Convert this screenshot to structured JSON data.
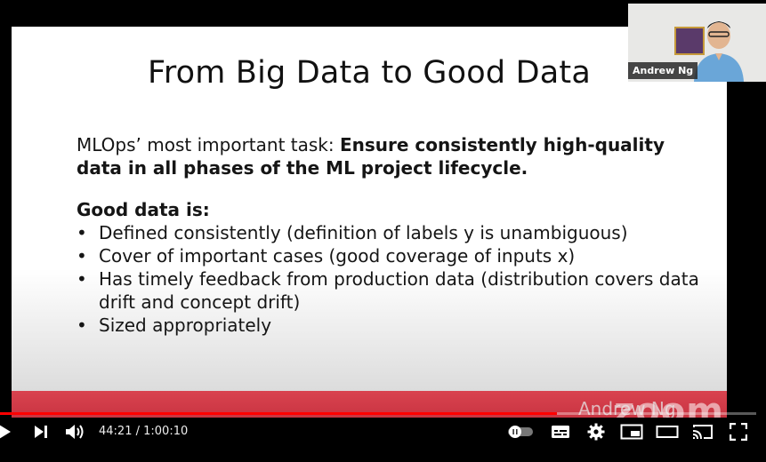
{
  "slide": {
    "title": "From Big Data to Good Data",
    "intro_prefix": "MLOps’ most important task: ",
    "intro_bold": "Ensure consistently high-quality data in all phases of the ML project lifecycle.",
    "good_heading": "Good data is:",
    "bullets": [
      "Defined consistently (definition of labels y is unambiguous)",
      "Cover of important cases (good coverage of inputs x)",
      "Has timely feedback from production data (distribution covers data drift and concept drift)",
      "Sized appropriately"
    ]
  },
  "webcam": {
    "name": "Andrew Ng"
  },
  "overlay": {
    "speaker_caption": "Andrew Ng",
    "logo_text": "zoom"
  },
  "player": {
    "current_time": "44:21",
    "separator": " / ",
    "duration": "1:00:10",
    "progress": 0.737,
    "accent_color": "#ff0000"
  },
  "icons": {
    "play": "play-icon",
    "next": "next-icon",
    "volume": "volume-icon",
    "autoplay": "autoplay-toggle-icon",
    "subtitles": "subtitles-icon",
    "settings": "gear-icon",
    "miniplayer": "miniplayer-icon",
    "theater": "theater-mode-icon",
    "cast": "cast-icon",
    "fullscreen": "fullscreen-icon"
  }
}
